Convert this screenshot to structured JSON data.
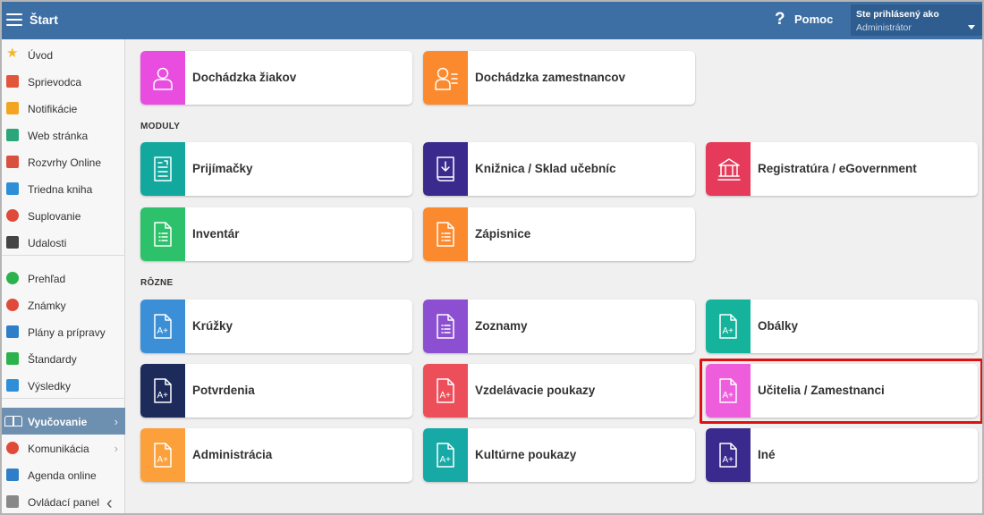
{
  "header": {
    "title": "Štart",
    "help_label": "Pomoc",
    "help_icon": "?",
    "user_line1": "Ste prihlásený ako",
    "user_line2": "Administrátor"
  },
  "sidebar": {
    "items": [
      {
        "label": "Úvod",
        "icon": "star-icon",
        "color": "#f3b82b"
      },
      {
        "label": "Sprievodca",
        "icon": "wand-icon",
        "color": "#e2553b"
      },
      {
        "label": "Notifikácie",
        "icon": "envelope-icon",
        "color": "#f3a521"
      },
      {
        "label": "Web stránka",
        "icon": "home-icon",
        "color": "#2aa67a"
      },
      {
        "label": "Rozvrhy Online",
        "icon": "timetable-icon",
        "color": "#d9503f"
      },
      {
        "label": "Triedna kniha",
        "icon": "book-icon",
        "color": "#2f8fd6"
      },
      {
        "label": "Suplovanie",
        "icon": "person-icon",
        "color": "#e04a3a"
      },
      {
        "label": "Udalosti",
        "icon": "calendar-icon",
        "color": "#444444"
      },
      {
        "label": "Prehľad",
        "icon": "check-circle-icon",
        "color": "#2bb24c"
      },
      {
        "label": "Známky",
        "icon": "grades-icon",
        "color": "#e04a3a"
      },
      {
        "label": "Plány a prípravy",
        "icon": "briefcase-icon",
        "color": "#2f7fc8"
      },
      {
        "label": "Štandardy",
        "icon": "shield-check-icon",
        "color": "#2bb24c"
      },
      {
        "label": "Výsledky",
        "icon": "bar-chart-icon",
        "color": "#2f8fd6"
      },
      {
        "label": "Vyučovanie",
        "icon": "open-book-icon",
        "color": "#ffffff"
      },
      {
        "label": "Komunikácia",
        "icon": "chat-icon",
        "color": "#e04a3a"
      },
      {
        "label": "Agenda online",
        "icon": "pen-icon",
        "color": "#2f7fc8"
      },
      {
        "label": "Ovládací panel",
        "icon": "gear-icon",
        "color": "#888888"
      }
    ],
    "collapse_icon": "‹"
  },
  "main": {
    "top_tiles": [
      {
        "label": "Dochádzka žiakov",
        "color": "#e94de0",
        "icon": "student-icon"
      },
      {
        "label": "Dochádzka zamestnancov",
        "color": "#fb8a2e",
        "icon": "employee-icon"
      }
    ],
    "moduly_title": "MODULY",
    "moduly": [
      {
        "label": "Prijímačky",
        "color": "#13a89e",
        "icon": "admission-form-icon"
      },
      {
        "label": "Knižnica / Sklad učebníc",
        "color": "#3b2a8e",
        "icon": "library-book-icon"
      },
      {
        "label": "Registratúra / eGovernment",
        "color": "#e63a5a",
        "icon": "government-building-icon"
      },
      {
        "label": "Inventár",
        "color": "#2ec16b",
        "icon": "inventory-document-icon"
      },
      {
        "label": "Zápisnice",
        "color": "#fb8a2e",
        "icon": "minutes-document-icon"
      }
    ],
    "rozne_title": "RÔZNE",
    "rozne": [
      {
        "label": "Krúžky",
        "color": "#3b8fd6",
        "icon": "a-plus-document-icon"
      },
      {
        "label": "Zoznamy",
        "color": "#8c4fd1",
        "icon": "list-document-icon"
      },
      {
        "label": "Obálky",
        "color": "#15b39b",
        "icon": "a-plus-document-icon"
      },
      {
        "label": "Potvrdenia",
        "color": "#1c2b5a",
        "icon": "a-plus-document-icon"
      },
      {
        "label": "Vzdelávacie poukazy",
        "color": "#ec4f5a",
        "icon": "a-plus-document-icon"
      },
      {
        "label": "Učitelia / Zamestnanci",
        "color": "#ee5ddb",
        "icon": "a-plus-document-icon"
      },
      {
        "label": "Administrácia",
        "color": "#fba03a",
        "icon": "a-plus-document-icon"
      },
      {
        "label": "Kultúrne poukazy",
        "color": "#17a9a6",
        "icon": "a-plus-document-icon"
      },
      {
        "label": "Iné",
        "color": "#3b2a8e",
        "icon": "a-plus-document-icon"
      }
    ]
  }
}
